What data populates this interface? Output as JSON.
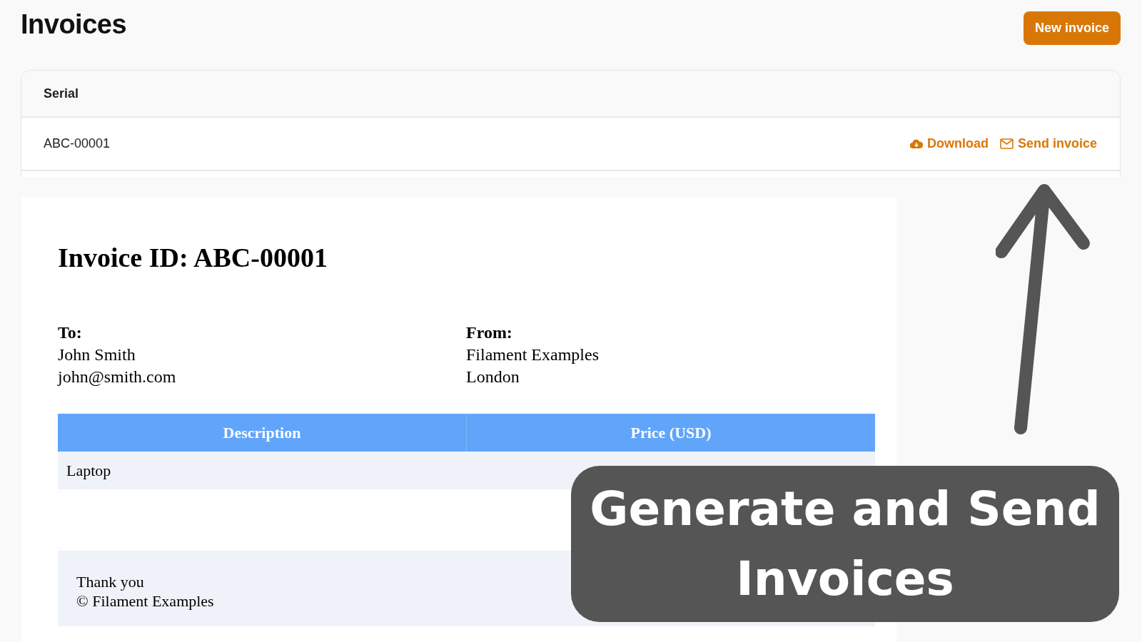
{
  "page": {
    "title": "Invoices",
    "primary_button": "New invoice"
  },
  "table": {
    "columns": [
      "Serial"
    ],
    "rows": [
      {
        "serial": "ABC-00001",
        "actions": [
          {
            "kind": "download",
            "label": "Download"
          },
          {
            "kind": "send",
            "label": "Send invoice"
          }
        ]
      }
    ]
  },
  "invoice_preview": {
    "heading": "Invoice ID: ABC-00001",
    "to": {
      "label": "To:",
      "lines": [
        "John Smith",
        "john@smith.com"
      ]
    },
    "from": {
      "label": "From:",
      "lines": [
        "Filament Examples",
        "London"
      ]
    },
    "columns": [
      "Description",
      "Price (USD)"
    ],
    "items": [
      {
        "description": "Laptop"
      }
    ],
    "footer": [
      "Thank you",
      "© Filament Examples"
    ]
  },
  "banner": {
    "text": "Generate and Send Invoices"
  }
}
